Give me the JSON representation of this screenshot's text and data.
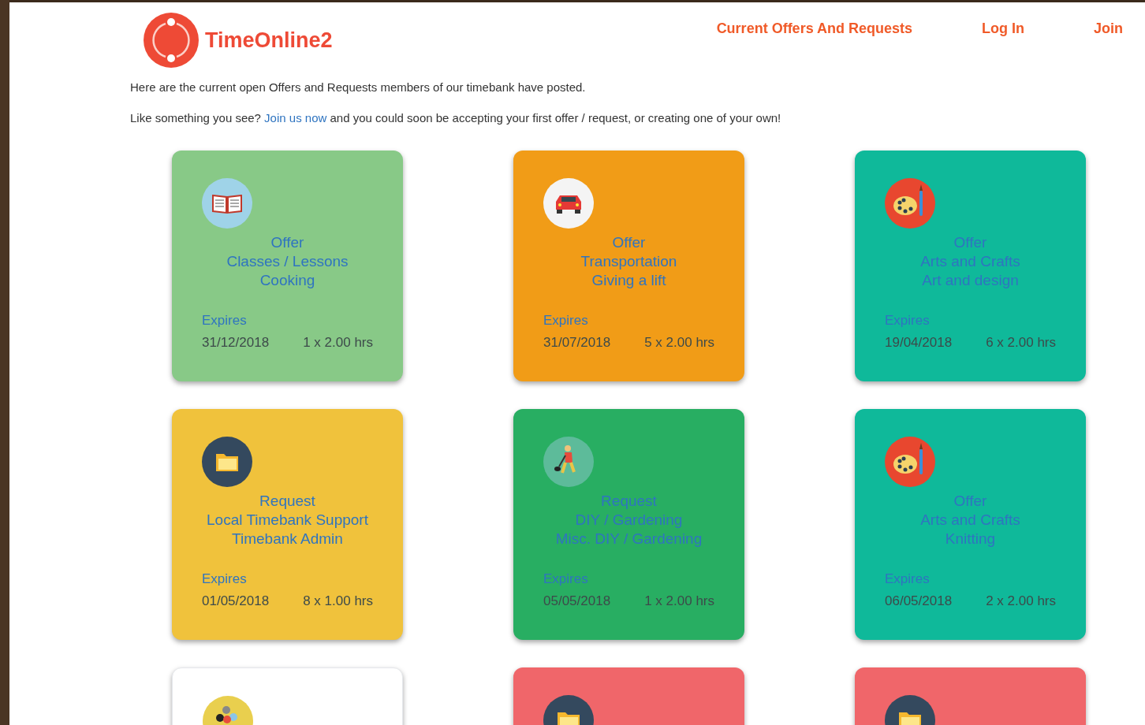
{
  "brand": {
    "name": "TimeOnline2"
  },
  "nav": [
    {
      "label": "Current Offers And Requests"
    },
    {
      "label": "Log In"
    },
    {
      "label": "Join"
    }
  ],
  "intro": "Here are the current open Offers and Requests members of our timebank have posted.",
  "invite": {
    "before": "Like something you see?",
    "link": "Join us now",
    "after": "and you could soon be accepting your first offer / request, or creating one of your own!"
  },
  "cards": [
    {
      "color": "#88c987",
      "kind": "book",
      "lines": [
        "Offer",
        "Classes / Lessons",
        "Cooking"
      ],
      "expires_label": "Expires",
      "date": "31/12/2018",
      "hours": "1 x 2.00 hrs"
    },
    {
      "color": "#f19c17",
      "kind": "car",
      "lines": [
        "Offer",
        "Transportation",
        "Giving a lift"
      ],
      "expires_label": "Expires",
      "date": "31/07/2018",
      "hours": "5 x 2.00 hrs"
    },
    {
      "color": "#0fb99a",
      "kind": "palette",
      "lines": [
        "Offer",
        "Arts and Crafts",
        "Art and design"
      ],
      "expires_label": "Expires",
      "date": "19/04/2018",
      "hours": "6 x 2.00 hrs"
    },
    {
      "color": "#f0c23c",
      "kind": "folder",
      "lines": [
        "Request",
        "Local Timebank Support",
        "Timebank Admin"
      ],
      "expires_label": "Expires",
      "date": "01/05/2018",
      "hours": "8 x 1.00 hrs"
    },
    {
      "color": "#28ae62",
      "kind": "worker",
      "lines": [
        "Request",
        "DIY / Gardening",
        "Misc. DIY / Gardening"
      ],
      "expires_label": "Expires",
      "date": "05/05/2018",
      "hours": "1 x 2.00 hrs"
    },
    {
      "color": "#0fb99a",
      "kind": "palette",
      "lines": [
        "Offer",
        "Arts and Crafts",
        "Knitting"
      ],
      "expires_label": "Expires",
      "date": "06/05/2018",
      "hours": "2 x 2.00 hrs"
    },
    {
      "color": "#ffffff",
      "kind": "people"
    },
    {
      "color": "#f0666a",
      "kind": "folder"
    },
    {
      "color": "#f0666a",
      "kind": "folder"
    }
  ]
}
